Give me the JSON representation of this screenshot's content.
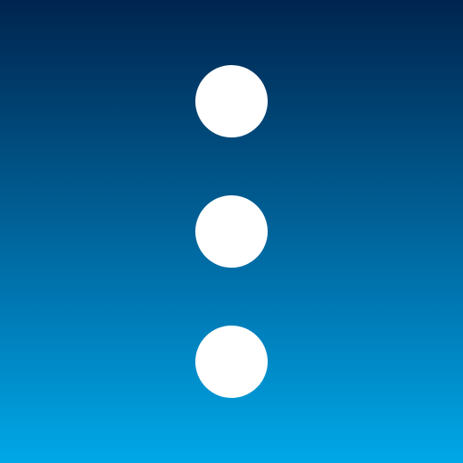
{
  "icon": {
    "name": "more-vertical-icon",
    "dot_color": "#ffffff",
    "gradient_top": "#00244f",
    "gradient_bottom": "#00a8e8",
    "dots": [
      {
        "name": "dot-top"
      },
      {
        "name": "dot-middle"
      },
      {
        "name": "dot-bottom"
      }
    ]
  }
}
